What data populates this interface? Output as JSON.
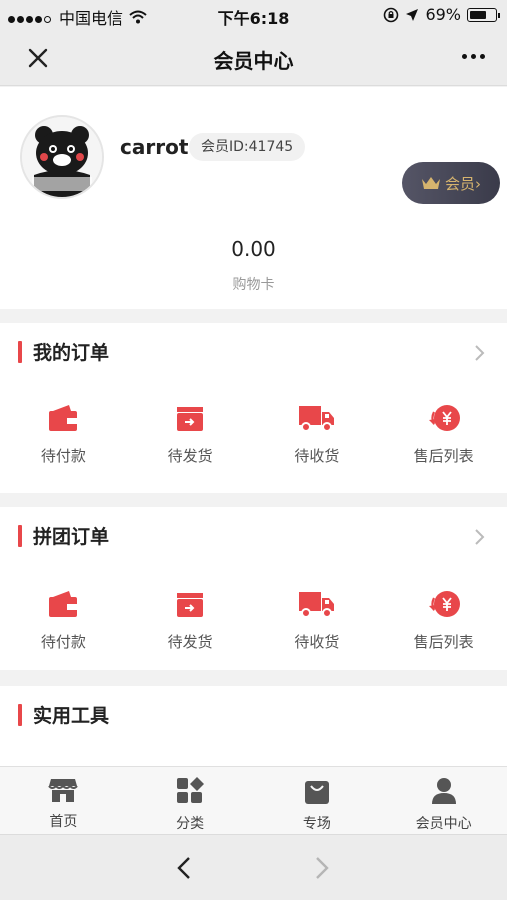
{
  "status_bar": {
    "carrier": "中国电信",
    "time": "下午6:18",
    "battery": "69%",
    "battery_level": 0.69
  },
  "nav": {
    "title": "会员中心"
  },
  "profile": {
    "username": "carrot",
    "member_id": "会员ID:41745",
    "badge_label": "会员›",
    "balance": "0.00",
    "balance_label": "购物卡"
  },
  "orders": {
    "title": "我的订单",
    "items": [
      {
        "label": "待付款",
        "icon": "wallet-icon"
      },
      {
        "label": "待发货",
        "icon": "box-icon"
      },
      {
        "label": "待收货",
        "icon": "truck-icon"
      },
      {
        "label": "售后列表",
        "icon": "refund-icon"
      }
    ]
  },
  "group_orders": {
    "title": "拼团订单",
    "items": [
      {
        "label": "待付款",
        "icon": "wallet-icon"
      },
      {
        "label": "待发货",
        "icon": "box-icon"
      },
      {
        "label": "待收货",
        "icon": "truck-icon"
      },
      {
        "label": "售后列表",
        "icon": "refund-icon"
      }
    ]
  },
  "tools": {
    "title": "实用工具"
  },
  "tab_bar": {
    "items": [
      {
        "label": "首页",
        "icon": "store-icon"
      },
      {
        "label": "分类",
        "icon": "grid-icon"
      },
      {
        "label": "专场",
        "icon": "bag-icon"
      },
      {
        "label": "会员中心",
        "icon": "person-icon"
      }
    ]
  },
  "colors": {
    "accent": "#e8474a",
    "badge_gold": "#d6b46e"
  }
}
